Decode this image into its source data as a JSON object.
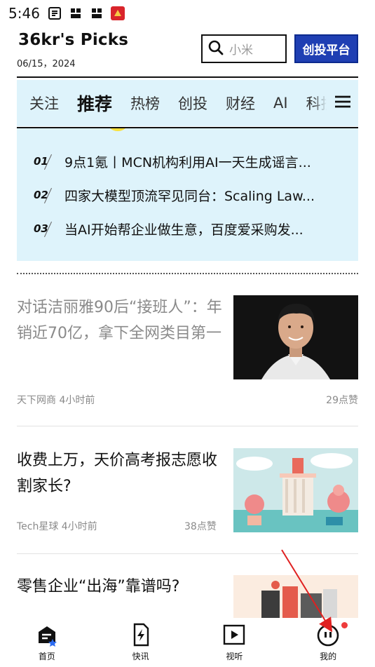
{
  "status_bar": {
    "time": "5:46"
  },
  "header": {
    "title": "36kr's Picks",
    "date": "06/15，2024",
    "search_placeholder": "小米",
    "chuangtou_button": "创投平台",
    "brand_color": "#1f3fb3"
  },
  "tabs": [
    {
      "label": "关注",
      "active": false
    },
    {
      "label": "推荐",
      "active": true
    },
    {
      "label": "热榜",
      "active": false
    },
    {
      "label": "创投",
      "active": false
    },
    {
      "label": "财经",
      "active": false
    },
    {
      "label": "AI",
      "active": false
    },
    {
      "label": "科技",
      "active": false
    }
  ],
  "hotlist": [
    {
      "rank": "01",
      "title": "9点1氪丨MCN机构利用AI一天生成谣言..."
    },
    {
      "rank": "02",
      "title": "四家大模型顶流罕见同台：Scaling Law..."
    },
    {
      "rank": "03",
      "title": "当AI开始帮企业做生意，百度爱采购发..."
    }
  ],
  "articles": [
    {
      "title": "对话洁丽雅90后“接班人”：年销近70亿，拿下全网类目第一",
      "source": "天下网商  4小时前",
      "likes": "29点赞",
      "read": true
    },
    {
      "title": "收费上万，天价高考报志愿收割家长?",
      "source": "Tech星球  4小时前",
      "likes": "38点赞",
      "read": false
    },
    {
      "title": "零售企业“出海”靠谱吗?",
      "source": "",
      "likes": "",
      "read": false
    }
  ],
  "bottom_nav": [
    {
      "label": "首页",
      "icon": "home-icon"
    },
    {
      "label": "快讯",
      "icon": "flash-news-icon"
    },
    {
      "label": "视听",
      "icon": "video-icon"
    },
    {
      "label": "我的",
      "icon": "profile-icon"
    }
  ]
}
